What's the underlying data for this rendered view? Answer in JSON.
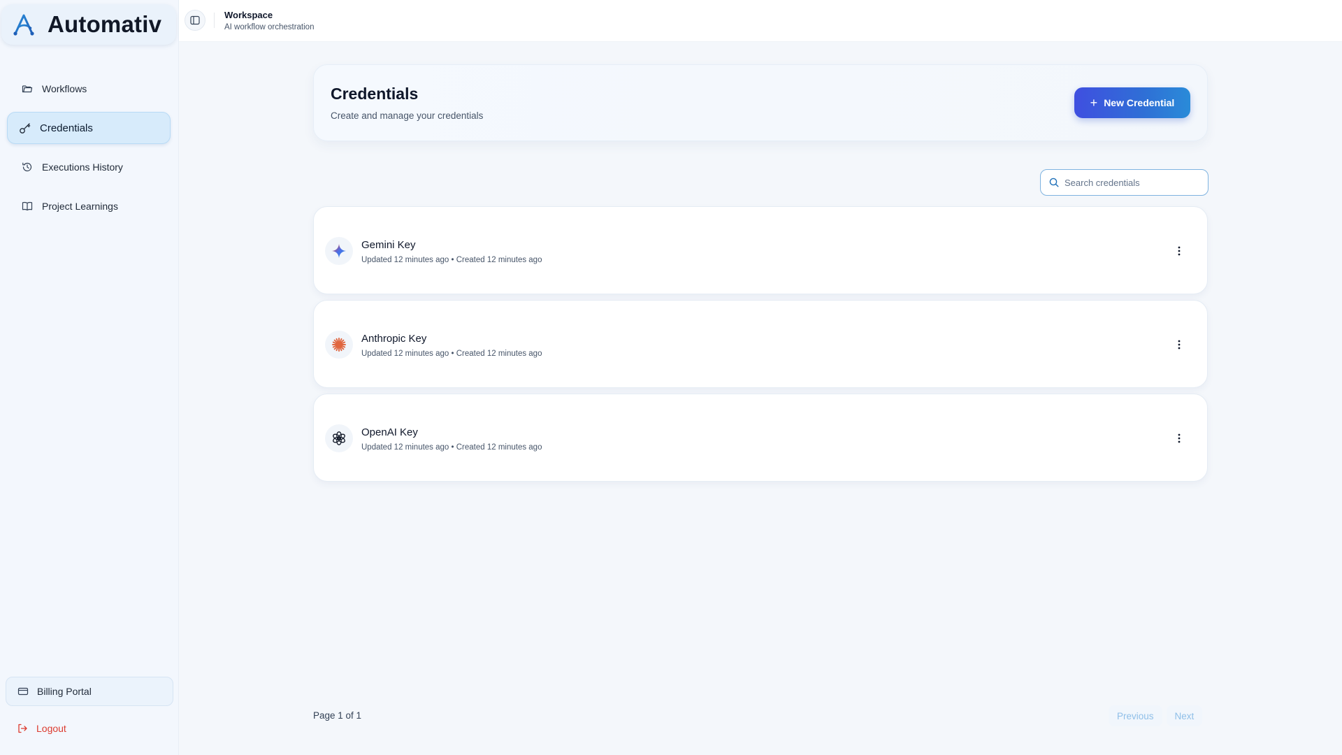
{
  "brand": {
    "name": "Automativ",
    "logo_icon": "automativ-logo-icon"
  },
  "sidebar": {
    "items": [
      {
        "label": "Workflows",
        "icon": "folder-icon"
      },
      {
        "label": "Credentials",
        "icon": "key-icon",
        "active": true
      },
      {
        "label": "Executions History",
        "icon": "history-icon"
      },
      {
        "label": "Project Learnings",
        "icon": "book-icon"
      }
    ],
    "billing_label": "Billing Portal",
    "logout_label": "Logout"
  },
  "topbar": {
    "workspace_title": "Workspace",
    "workspace_subtitle": "AI workflow orchestration",
    "toggle_icon": "sidebar-toggle-icon"
  },
  "header": {
    "title": "Credentials",
    "subtitle": "Create and manage your credentials",
    "new_button_label": "New Credential"
  },
  "search": {
    "placeholder": "Search credentials",
    "value": ""
  },
  "credentials": [
    {
      "name": "Gemini Key",
      "meta": "Updated 12 minutes ago • Created 12 minutes ago",
      "icon": "gemini-icon"
    },
    {
      "name": "Anthropic Key",
      "meta": "Updated 12 minutes ago • Created 12 minutes ago",
      "icon": "anthropic-icon"
    },
    {
      "name": "OpenAI Key",
      "meta": "Updated 12 minutes ago • Created 12 minutes ago",
      "icon": "openai-icon"
    }
  ],
  "pagination": {
    "info": "Page 1 of 1",
    "previous_label": "Previous",
    "next_label": "Next"
  },
  "colors": {
    "accent": "#2f6fd6",
    "active_nav_bg": "#d7ebfb",
    "logout": "#dc3b2f",
    "pager_text": "#8fbfe8"
  }
}
